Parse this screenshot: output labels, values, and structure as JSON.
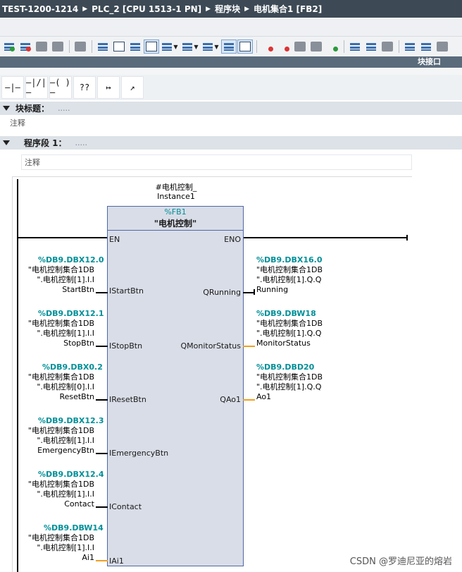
{
  "breadcrumb": [
    {
      "label": "TEST-1200-1214"
    },
    {
      "label": "PLC_2 [CPU 1513-1 PN]"
    },
    {
      "label": "程序块"
    },
    {
      "label": "电机集合1 [FB2]"
    }
  ],
  "subbar": {
    "interface_label": "块接口"
  },
  "toolbar": {
    "icons": [
      "insert-network-icon",
      "delete-network-icon",
      "insert-row-icon",
      "append-row-icon",
      "abs-operand-icon",
      "open-all-networks-icon",
      "close-all-networks-icon",
      "toggle-comments-icon",
      "favorites-icon",
      "sel-operand-icon",
      "display-format-icon",
      "network-layout-icon",
      "show-comments-icon",
      "favorites-bar-icon",
      "go-to-icon",
      "breakpoint-icon",
      "clear-icon",
      "monitor-icon",
      "download-icon",
      "compare-icon",
      "callstack-icon",
      "single-step-icon",
      "run-icon",
      "history-icon",
      "more-icon"
    ]
  },
  "palette": {
    "items": [
      {
        "name": "no-contact-icon",
        "glyph": "—|—"
      },
      {
        "name": "nc-contact-icon",
        "glyph": "—|/|—"
      },
      {
        "name": "coil-icon",
        "glyph": "—( )—"
      },
      {
        "name": "empty-box-icon",
        "glyph": "??"
      },
      {
        "name": "open-branch-icon",
        "glyph": "↦"
      },
      {
        "name": "close-branch-icon",
        "glyph": "↗"
      }
    ]
  },
  "block": {
    "title_label": "块标题：",
    "title_dots": ".....",
    "comment": "注释"
  },
  "network": {
    "title_label": "程序段 1：",
    "title_dots": ".....",
    "comment": "注释"
  },
  "fb_call": {
    "instance_line1": "#电机控制_",
    "instance_line2": "Instance1",
    "type": "%FB1",
    "name": "\"电机控制\"",
    "en": "EN",
    "eno": "ENO",
    "inputs": [
      {
        "pin": "IStartBtn",
        "addr": "%DB9.DBX12.0",
        "line1": "\"电机控制集合1DB",
        "line2": "\".电机控制[1].I.I",
        "line3": "StartBtn"
      },
      {
        "pin": "IStopBtn",
        "addr": "%DB9.DBX12.1",
        "line1": "\"电机控制集合1DB",
        "line2": "\".电机控制[1].I.I",
        "line3": "StopBtn"
      },
      {
        "pin": "IResetBtn",
        "addr": "%DB9.DBX0.2",
        "line1": "\"电机控制集合1DB",
        "line2": "\".电机控制[0].I.I",
        "line3": "ResetBtn"
      },
      {
        "pin": "IEmergencyBtn",
        "addr": "%DB9.DBX12.3",
        "line1": "\"电机控制集合1DB",
        "line2": "\".电机控制[1].I.I",
        "line3": "EmergencyBtn"
      },
      {
        "pin": "IContact",
        "addr": "%DB9.DBX12.4",
        "line1": "\"电机控制集合1DB",
        "line2": "\".电机控制[1].I.I",
        "line3": "Contact"
      },
      {
        "pin": "IAi1",
        "addr": "%DB9.DBW14",
        "line1": "\"电机控制集合1DB",
        "line2": "\".电机控制[1].I.I",
        "line3": "Ai1"
      }
    ],
    "outputs": [
      {
        "pin": "QRunning",
        "addr": "%DB9.DBX16.0",
        "line1": "\"电机控制集合1DB",
        "line2": "\".电机控制[1].Q.Q",
        "line3": "Running"
      },
      {
        "pin": "QMonitorStatus",
        "addr": "%DB9.DBW18",
        "line1": "\"电机控制集合1DB",
        "line2": "\".电机控制[1].Q.Q",
        "line3": "MonitorStatus"
      },
      {
        "pin": "QAo1",
        "addr": "%DB9.DBD20",
        "line1": "\"电机控制集合1DB",
        "line2": "\".电机控制[1].Q.Q",
        "line3": "Ao1"
      }
    ]
  },
  "watermark": "CSDN @罗迪尼亚的熔岩"
}
